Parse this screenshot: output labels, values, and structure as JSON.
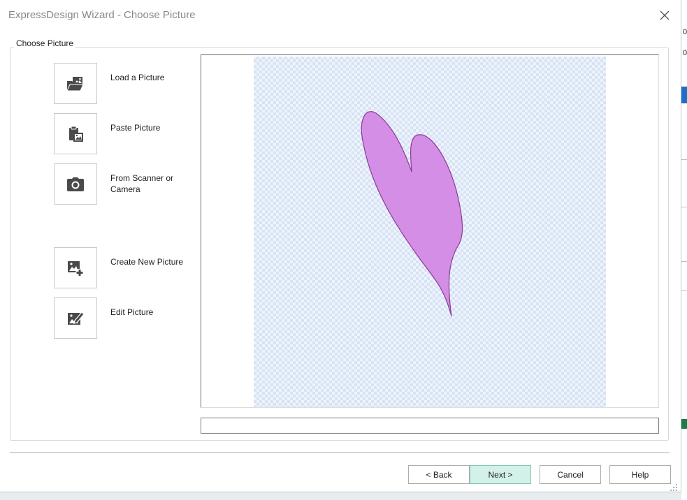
{
  "window": {
    "title": "ExpressDesign Wizard - Choose Picture",
    "close_icon": "close-icon"
  },
  "group": {
    "label": "Choose Picture"
  },
  "tools": [
    {
      "label": "Load a Picture",
      "icon": "folder-picture-icon"
    },
    {
      "label": "Paste Picture",
      "icon": "clipboard-picture-icon"
    },
    {
      "label": "From Scanner or Camera",
      "icon": "camera-icon"
    },
    {
      "label": "Create New Picture",
      "icon": "picture-add-icon"
    },
    {
      "label": "Edit Picture",
      "icon": "picture-edit-icon"
    }
  ],
  "preview": {
    "shape_fill": "#d48ee6",
    "shape_stroke": "#8a3a96",
    "checker_color": "#d7e3f5"
  },
  "path_field": {
    "value": ""
  },
  "buttons": {
    "back": "< Back",
    "next": "Next >",
    "cancel": "Cancel",
    "help": "Help"
  },
  "background_app": {
    "digits": [
      "0",
      "0"
    ]
  },
  "colors": {
    "accent_button": "#d4f1e9",
    "title_text": "#888888"
  }
}
